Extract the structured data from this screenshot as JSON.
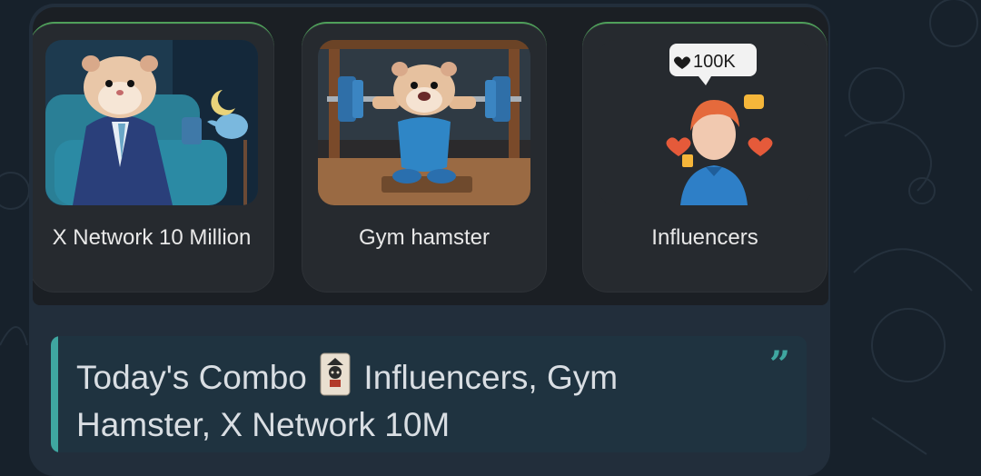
{
  "cards": [
    {
      "label": "X Network 10 Million",
      "icon": "hamster-businessman-image"
    },
    {
      "label": "Gym hamster",
      "icon": "hamster-weightlifting-image"
    },
    {
      "label": "Influencers",
      "icon": "influencer-icon",
      "badge": "100K"
    }
  ],
  "quote": {
    "prefix": "Today's Combo",
    "emoji": "joker-card-emoji",
    "text": "Influencers, Gym",
    "line2": "Hamster, X Network 10M"
  },
  "colors": {
    "background": "#17212b",
    "bubble": "#222e3b",
    "card": "#262a2f",
    "card_accent": "#4f9f5a",
    "quote_accent": "#3fa6a0"
  }
}
